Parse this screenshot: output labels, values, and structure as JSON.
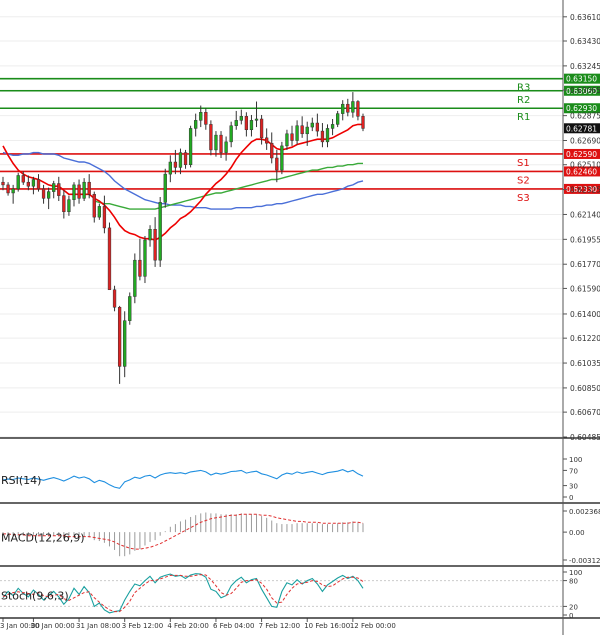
{
  "chart_data": {
    "type": "candlestick",
    "main": {
      "ylim": [
        0.60485,
        0.63735
      ],
      "price_ticks": [
        "0.63610",
        "0.63430",
        "0.63245",
        "0.63065",
        "0.62875",
        "0.62690",
        "0.62510",
        "0.62325",
        "0.62140",
        "0.61955",
        "0.61770",
        "0.61590",
        "0.61400",
        "0.61220",
        "0.61035",
        "0.60850",
        "0.60670",
        "0.60485"
      ],
      "price_tick_values": [
        0.6361,
        0.6343,
        0.63245,
        0.63065,
        0.62875,
        0.6269,
        0.6251,
        0.62325,
        0.6214,
        0.61955,
        0.6177,
        0.6159,
        0.614,
        0.6122,
        0.61035,
        0.6085,
        0.6067,
        0.60485
      ],
      "current_price": {
        "label": "0.62781",
        "value": 0.62781
      },
      "levels": [
        {
          "name": "R3",
          "label": "0.63150",
          "value": 0.6315
        },
        {
          "name": "R2",
          "label": "0.63060",
          "value": 0.6306
        },
        {
          "name": "R1",
          "label": "0.62930",
          "value": 0.6293
        },
        {
          "name": "S1",
          "label": "0.62590",
          "value": 0.6259
        },
        {
          "name": "S2",
          "label": "0.62460",
          "value": 0.6246
        },
        {
          "name": "S3",
          "label": "0.62330",
          "value": 0.6233
        }
      ],
      "candles": [
        [
          0.6238,
          0.6242,
          0.6232,
          0.6236
        ],
        [
          0.6236,
          0.6238,
          0.6228,
          0.623
        ],
        [
          0.623,
          0.6236,
          0.6222,
          0.6233
        ],
        [
          0.6233,
          0.6245,
          0.6231,
          0.6243
        ],
        [
          0.6243,
          0.6246,
          0.6236,
          0.6238
        ],
        [
          0.6238,
          0.6243,
          0.6232,
          0.6235
        ],
        [
          0.6235,
          0.6242,
          0.6229,
          0.624
        ],
        [
          0.624,
          0.6244,
          0.6231,
          0.6233
        ],
        [
          0.6233,
          0.6236,
          0.6222,
          0.6226
        ],
        [
          0.6226,
          0.6234,
          0.6218,
          0.6231
        ],
        [
          0.6231,
          0.6239,
          0.6226,
          0.6237
        ],
        [
          0.6237,
          0.6242,
          0.6224,
          0.6228
        ],
        [
          0.6228,
          0.6232,
          0.6211,
          0.6216
        ],
        [
          0.6216,
          0.6228,
          0.6213,
          0.6225
        ],
        [
          0.6225,
          0.6238,
          0.622,
          0.6236
        ],
        [
          0.6236,
          0.624,
          0.6222,
          0.6226
        ],
        [
          0.6226,
          0.6241,
          0.6224,
          0.6238
        ],
        [
          0.6238,
          0.6244,
          0.6226,
          0.6229
        ],
        [
          0.6229,
          0.6231,
          0.6208,
          0.6212
        ],
        [
          0.6212,
          0.6222,
          0.621,
          0.622
        ],
        [
          0.622,
          0.6228,
          0.62,
          0.6204
        ],
        [
          0.6204,
          0.6208,
          0.6165,
          0.6158
        ],
        [
          0.6158,
          0.6161,
          0.6142,
          0.6145
        ],
        [
          0.6145,
          0.6146,
          0.6088,
          0.6101
        ],
        [
          0.6101,
          0.6142,
          0.6093,
          0.6135
        ],
        [
          0.6135,
          0.6156,
          0.6132,
          0.6153
        ],
        [
          0.6153,
          0.6185,
          0.6148,
          0.618
        ],
        [
          0.618,
          0.6196,
          0.6165,
          0.6168
        ],
        [
          0.6168,
          0.6198,
          0.6163,
          0.6195
        ],
        [
          0.6195,
          0.6206,
          0.619,
          0.6203
        ],
        [
          0.6203,
          0.6212,
          0.6175,
          0.618
        ],
        [
          0.618,
          0.6227,
          0.6175,
          0.6223
        ],
        [
          0.6223,
          0.6248,
          0.6219,
          0.6244
        ],
        [
          0.6244,
          0.6258,
          0.6238,
          0.6253
        ],
        [
          0.6253,
          0.6262,
          0.6244,
          0.6249
        ],
        [
          0.6249,
          0.6263,
          0.6244,
          0.626
        ],
        [
          0.626,
          0.6262,
          0.6248,
          0.6251
        ],
        [
          0.6251,
          0.628,
          0.6249,
          0.6278
        ],
        [
          0.6278,
          0.6289,
          0.6272,
          0.6284
        ],
        [
          0.6284,
          0.6295,
          0.6279,
          0.629
        ],
        [
          0.629,
          0.6293,
          0.6277,
          0.6281
        ],
        [
          0.6281,
          0.6284,
          0.6258,
          0.6262
        ],
        [
          0.6262,
          0.6276,
          0.6257,
          0.6273
        ],
        [
          0.6273,
          0.6276,
          0.6256,
          0.626
        ],
        [
          0.626,
          0.6272,
          0.6254,
          0.6268
        ],
        [
          0.6268,
          0.6283,
          0.6264,
          0.628
        ],
        [
          0.628,
          0.6291,
          0.6277,
          0.6284
        ],
        [
          0.6284,
          0.6292,
          0.6281,
          0.6287
        ],
        [
          0.6287,
          0.629,
          0.6272,
          0.6277
        ],
        [
          0.6277,
          0.6288,
          0.6272,
          0.6284
        ],
        [
          0.6284,
          0.6298,
          0.6279,
          0.6285
        ],
        [
          0.6285,
          0.6288,
          0.6266,
          0.6271
        ],
        [
          0.6271,
          0.6278,
          0.6262,
          0.6267
        ],
        [
          0.6267,
          0.6275,
          0.6252,
          0.6256
        ],
        [
          0.6256,
          0.6262,
          0.6238,
          0.6247
        ],
        [
          0.6247,
          0.6268,
          0.6244,
          0.6265
        ],
        [
          0.6265,
          0.6277,
          0.6262,
          0.6274
        ],
        [
          0.6274,
          0.628,
          0.6265,
          0.6269
        ],
        [
          0.6269,
          0.6284,
          0.6266,
          0.628
        ],
        [
          0.628,
          0.6287,
          0.6271,
          0.6274
        ],
        [
          0.6274,
          0.6283,
          0.6265,
          0.6279
        ],
        [
          0.6279,
          0.6286,
          0.6276,
          0.6282
        ],
        [
          0.6282,
          0.6289,
          0.6272,
          0.6276
        ],
        [
          0.6276,
          0.6282,
          0.6264,
          0.6268
        ],
        [
          0.6268,
          0.6281,
          0.6264,
          0.6278
        ],
        [
          0.6278,
          0.6285,
          0.6273,
          0.6281
        ],
        [
          0.6281,
          0.6291,
          0.6279,
          0.6289
        ],
        [
          0.6289,
          0.6299,
          0.6284,
          0.6296
        ],
        [
          0.6296,
          0.63,
          0.6287,
          0.629
        ],
        [
          0.629,
          0.6305,
          0.6286,
          0.6298
        ],
        [
          0.6298,
          0.6299,
          0.6284,
          0.6287
        ],
        [
          0.6287,
          0.6289,
          0.6276,
          0.6278
        ]
      ],
      "ma_red": [
        0.6265,
        0.6258,
        0.6252,
        0.6247,
        0.6244,
        0.6242,
        0.6241,
        0.624,
        0.6238,
        0.6236,
        0.6235,
        0.6235,
        0.6232,
        0.6229,
        0.6229,
        0.6229,
        0.6229,
        0.6229,
        0.6226,
        0.6224,
        0.6221,
        0.6217,
        0.6212,
        0.6206,
        0.6202,
        0.62,
        0.6199,
        0.6197,
        0.6196,
        0.6196,
        0.6195,
        0.6197,
        0.62,
        0.6204,
        0.6207,
        0.6211,
        0.6213,
        0.6216,
        0.622,
        0.6224,
        0.6229,
        0.6233,
        0.6237,
        0.624,
        0.6244,
        0.6249,
        0.6255,
        0.626,
        0.6264,
        0.6268,
        0.627,
        0.627,
        0.6269,
        0.6266,
        0.6263,
        0.6262,
        0.6263,
        0.6264,
        0.6266,
        0.6267,
        0.6268,
        0.6269,
        0.627,
        0.627,
        0.627,
        0.6271,
        0.6273,
        0.6275,
        0.6277,
        0.628,
        0.6281,
        0.6281
      ],
      "ma_blue": [
        0.626,
        0.6259,
        0.6258,
        0.6258,
        0.6259,
        0.6259,
        0.626,
        0.626,
        0.6259,
        0.6259,
        0.6259,
        0.6258,
        0.6256,
        0.6255,
        0.6254,
        0.6253,
        0.6253,
        0.6252,
        0.625,
        0.6248,
        0.6246,
        0.6243,
        0.6239,
        0.6236,
        0.6233,
        0.6231,
        0.6229,
        0.6227,
        0.6225,
        0.6224,
        0.6223,
        0.6222,
        0.6222,
        0.6221,
        0.6221,
        0.6221,
        0.622,
        0.622,
        0.6219,
        0.6219,
        0.6219,
        0.6218,
        0.6218,
        0.6218,
        0.6218,
        0.6218,
        0.6219,
        0.6219,
        0.6219,
        0.6219,
        0.622,
        0.622,
        0.6221,
        0.6221,
        0.6222,
        0.6222,
        0.6223,
        0.6224,
        0.6225,
        0.6226,
        0.6227,
        0.6228,
        0.6229,
        0.6229,
        0.623,
        0.6231,
        0.6232,
        0.6233,
        0.6235,
        0.6236,
        0.6238,
        0.6239
      ],
      "ma_green": [
        null,
        null,
        null,
        null,
        null,
        null,
        null,
        null,
        null,
        null,
        null,
        null,
        null,
        null,
        null,
        null,
        null,
        null,
        0.6224,
        0.6223,
        0.6222,
        0.6222,
        0.6221,
        0.622,
        0.6219,
        0.6218,
        0.6218,
        0.6218,
        0.6218,
        0.6218,
        0.6218,
        0.6219,
        0.622,
        0.6221,
        0.6222,
        0.6223,
        0.6224,
        0.6225,
        0.6226,
        0.6227,
        0.6228,
        0.6229,
        0.623,
        0.623,
        0.6231,
        0.6232,
        0.6233,
        0.6234,
        0.6235,
        0.6236,
        0.6237,
        0.6238,
        0.6239,
        0.624,
        0.624,
        0.6241,
        0.6242,
        0.6243,
        0.6244,
        0.6245,
        0.6246,
        0.6247,
        0.6247,
        0.6248,
        0.6249,
        0.6249,
        0.625,
        0.625,
        0.6251,
        0.6251,
        0.6252,
        0.6252
      ]
    },
    "time_labels": [
      "3 Jan 00:00",
      "30 Jan 00:00",
      "31 Jan 08:00",
      "3 Feb 12:00",
      "4 Feb 20:00",
      "6 Feb 04:00",
      "7 Feb 12:00",
      "10 Feb 16:00",
      "12 Feb 00:00"
    ],
    "time_label_bars": [
      0,
      6,
      15,
      24,
      33,
      42,
      51,
      60,
      69
    ],
    "rsi": {
      "title": "RSI(14)",
      "ticks": [
        "100",
        "70",
        "30",
        "0"
      ],
      "tick_values": [
        100,
        70,
        30,
        0
      ],
      "ylim": [
        0,
        100
      ],
      "values": [
        45,
        47,
        46,
        50,
        48,
        46,
        50,
        47,
        44,
        48,
        51,
        47,
        42,
        48,
        55,
        50,
        53,
        48,
        38,
        44,
        40,
        32,
        26,
        23,
        40,
        45,
        52,
        49,
        55,
        57,
        50,
        58,
        62,
        64,
        62,
        64,
        61,
        66,
        68,
        70,
        66,
        58,
        63,
        60,
        63,
        67,
        68,
        70,
        63,
        66,
        68,
        61,
        58,
        53,
        48,
        58,
        63,
        60,
        66,
        62,
        65,
        67,
        63,
        59,
        64,
        66,
        68,
        72,
        66,
        70,
        61,
        55
      ]
    },
    "macd": {
      "title": "MACD(12,26,9)",
      "ticks": [
        "0.002368",
        "0.00",
        "-0.003127"
      ],
      "tick_values": [
        0.002368,
        0,
        -0.003127
      ],
      "ylim": [
        -0.003127,
        0.002368
      ],
      "hist": [
        -0.0002,
        -0.0003,
        -0.0004,
        -0.0004,
        -0.0004,
        -0.0004,
        -0.0003,
        -0.0003,
        -0.0004,
        -0.0004,
        -0.0004,
        -0.0004,
        -0.0006,
        -0.0007,
        -0.0006,
        -0.0006,
        -0.0005,
        -0.0006,
        -0.0009,
        -0.001,
        -0.0012,
        -0.0016,
        -0.002,
        -0.0027,
        -0.0027,
        -0.0025,
        -0.0021,
        -0.0019,
        -0.0015,
        -0.0011,
        -0.0009,
        -0.0004,
        0.0001,
        0.0006,
        0.0009,
        0.0012,
        0.0014,
        0.0017,
        0.0019,
        0.0021,
        0.0022,
        0.0021,
        0.0021,
        0.002,
        0.002,
        0.002,
        0.002,
        0.0021,
        0.002,
        0.002,
        0.002,
        0.0018,
        0.0016,
        0.0013,
        0.001,
        0.0009,
        0.0009,
        0.0009,
        0.001,
        0.001,
        0.001,
        0.001,
        0.001,
        0.0009,
        0.0009,
        0.0009,
        0.001,
        0.0011,
        0.0011,
        0.0012,
        0.0011,
        0.001
      ],
      "signal": [
        -0.0002,
        -0.0002,
        -0.0003,
        -0.0003,
        -0.0003,
        -0.0004,
        -0.0004,
        -0.0004,
        -0.0004,
        -0.0004,
        -0.0004,
        -0.0004,
        -0.0004,
        -0.0005,
        -0.0005,
        -0.0005,
        -0.0005,
        -0.0005,
        -0.0006,
        -0.0007,
        -0.0008,
        -0.0009,
        -0.0011,
        -0.0014,
        -0.0016,
        -0.0018,
        -0.0019,
        -0.0019,
        -0.0018,
        -0.0017,
        -0.0015,
        -0.0013,
        -0.001,
        -0.0007,
        -0.0004,
        -0.0001,
        0.0002,
        0.0005,
        0.0008,
        0.0011,
        0.0013,
        0.0015,
        0.0016,
        0.0017,
        0.0018,
        0.0019,
        0.0019,
        0.002,
        0.002,
        0.002,
        0.002,
        0.0019,
        0.0019,
        0.0018,
        0.0016,
        0.0015,
        0.0014,
        0.0013,
        0.0012,
        0.0012,
        0.0011,
        0.0011,
        0.0011,
        0.001,
        0.001,
        0.001,
        0.001,
        0.001,
        0.001,
        0.0011,
        0.0011,
        0.001
      ]
    },
    "stoch": {
      "title": "Stoch(9,6,3)",
      "ticks": [
        "100",
        "80",
        "20",
        "0"
      ],
      "tick_values": [
        100,
        80,
        20,
        0
      ],
      "ylim": [
        0,
        100
      ],
      "main": [
        40,
        55,
        45,
        62,
        50,
        42,
        58,
        48,
        35,
        45,
        55,
        42,
        25,
        38,
        62,
        48,
        66,
        52,
        20,
        28,
        12,
        5,
        8,
        10,
        35,
        55,
        72,
        68,
        80,
        90,
        75,
        88,
        92,
        95,
        90,
        92,
        85,
        93,
        96,
        95,
        88,
        60,
        55,
        40,
        45,
        68,
        80,
        88,
        75,
        82,
        85,
        60,
        40,
        20,
        18,
        55,
        75,
        70,
        82,
        72,
        80,
        85,
        72,
        55,
        70,
        78,
        86,
        92,
        85,
        90,
        80,
        62
      ],
      "signal": [
        42,
        48,
        52,
        54,
        52,
        50,
        48,
        52,
        45,
        42,
        46,
        48,
        38,
        34,
        40,
        46,
        52,
        54,
        40,
        30,
        20,
        12,
        8,
        8,
        18,
        32,
        52,
        62,
        72,
        80,
        80,
        84,
        88,
        92,
        92,
        92,
        90,
        90,
        92,
        94,
        93,
        82,
        68,
        52,
        46,
        50,
        62,
        76,
        80,
        80,
        82,
        74,
        60,
        40,
        28,
        30,
        48,
        62,
        72,
        74,
        76,
        80,
        78,
        70,
        66,
        68,
        76,
        84,
        88,
        88,
        86,
        78
      ]
    }
  },
  "colors": {
    "bull": "#22aa22",
    "bear": "#dd2222",
    "ma_red": "#ee0000",
    "ma_blue": "#4a6fd8",
    "ma_green": "#3aaa3a",
    "level_resistance": "#1a8c1a",
    "level_support": "#dd1111",
    "rsi_line": "#1f8fe0",
    "macd_hist": "#9a9a9a",
    "macd_signal": "#e03030",
    "stoch_main": "#1aa0a0",
    "stoch_signal": "#e03030"
  }
}
